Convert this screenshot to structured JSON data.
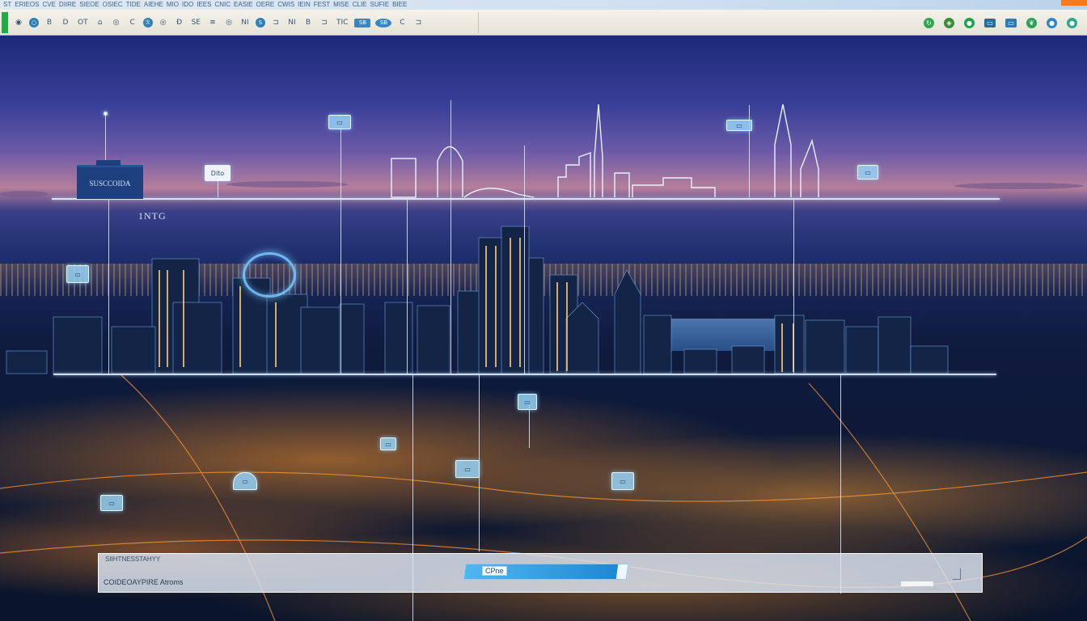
{
  "menu": {
    "items": [
      "ST",
      "ERIEOS",
      "CVE",
      "DIIRE",
      "SIEOE",
      "OSIEC",
      "TIDE",
      "AIEHE",
      "MIO",
      "IDO",
      "IEES",
      "CNIC",
      "EASIE",
      "OERE",
      "CWIS",
      "IEIN",
      "FEST",
      "MISE",
      "CLIE",
      "SUFIE",
      "BIEE"
    ]
  },
  "toolbar": {
    "left_buttons": [
      "◉",
      "○",
      "B",
      "D",
      "OT",
      "⌂",
      "◎",
      "C",
      "ℛ",
      "◎",
      "Đ",
      "SE",
      "≡",
      "◎",
      "NI",
      "S",
      "⊐",
      "NI",
      "B",
      "⊐",
      "TIC",
      "SB",
      "SB",
      "C",
      "⊐"
    ],
    "right_icons": [
      {
        "name": "refresh-icon",
        "color": "#2ea84a",
        "glyph": "↻"
      },
      {
        "name": "shield-icon",
        "color": "#3c8d3a",
        "glyph": "◈"
      },
      {
        "name": "globe-icon",
        "color": "#19a44f",
        "glyph": "●"
      },
      {
        "name": "monitor-icon",
        "color": "#1f6fa8",
        "glyph": "▭"
      },
      {
        "name": "window-icon",
        "color": "#2a7cb8",
        "glyph": "▭"
      },
      {
        "name": "leaf-icon",
        "color": "#2aa05a",
        "glyph": "❦"
      },
      {
        "name": "chat-icon",
        "color": "#2e86c4",
        "glyph": "●"
      },
      {
        "name": "drop-icon",
        "color": "#2ba88c",
        "glyph": "●"
      }
    ]
  },
  "map": {
    "building_label": "SUSCCOIDA",
    "chart_number": "1NTG",
    "tags": {
      "tag_top_left": "Dito",
      "tag_top_mid": "▭",
      "tag_top_right": "▭",
      "tag_far_right": "▭",
      "tag_left": "▭",
      "tag_mid1": "▭",
      "tag_mid2": "▭",
      "tag_mid3": "▭",
      "tag_mid4": "▭",
      "tag_lower_left": "▭",
      "tag_dome": "▭"
    }
  },
  "bottom_panel": {
    "title": "SIIHTNESSTAHYY",
    "subtitle": "COIDEOAYPIRE Atroms",
    "progress_label": "CPne",
    "progress_value": 0.94
  }
}
